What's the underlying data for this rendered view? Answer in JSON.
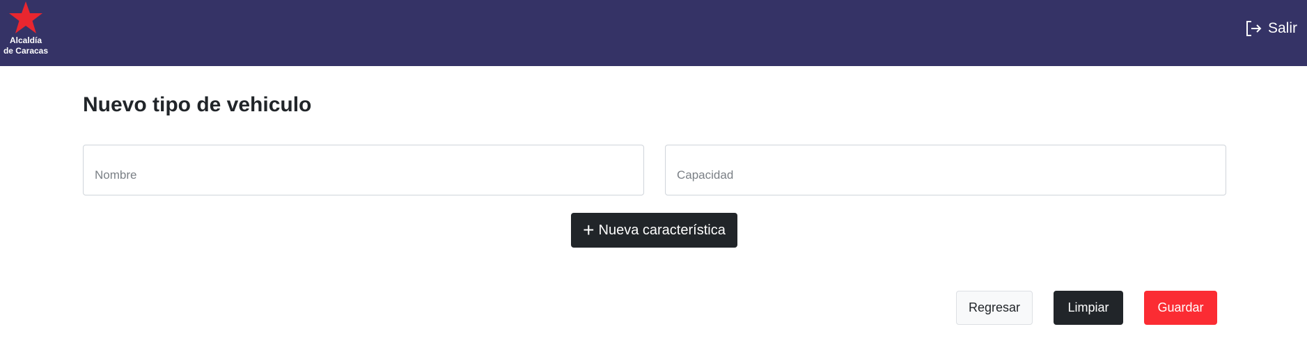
{
  "header": {
    "logo_line1": "Alcaldía",
    "logo_line2": "de Caracas",
    "logout_label": "Salir",
    "brand_color": "#353366",
    "star_color": "#e8262f"
  },
  "form": {
    "title": "Nuevo tipo de vehiculo",
    "name_placeholder": "Nombre",
    "name_value": "",
    "capacity_placeholder": "Capacidad",
    "capacity_value": "",
    "add_feature_label": "Nueva característica"
  },
  "actions": {
    "back_label": "Regresar",
    "clear_label": "Limpiar",
    "save_label": "Guardar",
    "save_color": "#fb2c33"
  }
}
